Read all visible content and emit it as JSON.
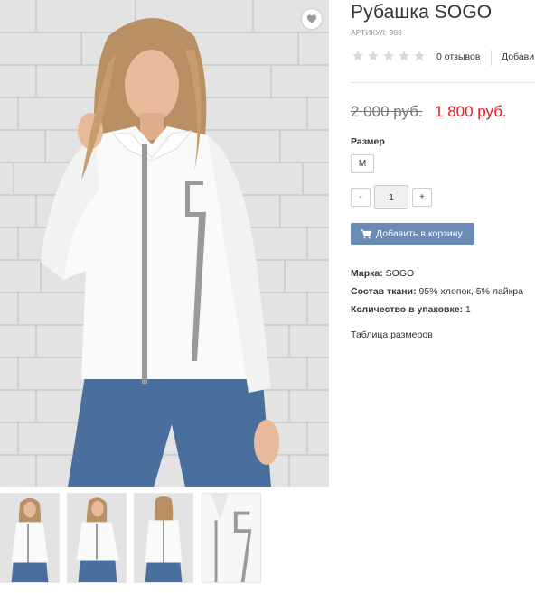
{
  "product": {
    "title": "Рубашка SOGO",
    "sku": "АРТИКУЛ: 988"
  },
  "rating": {
    "stars_filled": 0,
    "stars_total": 5,
    "reviews_text": "0 отзывов",
    "add_review_text": "Добави"
  },
  "price": {
    "old": "2 000 руб.",
    "current": "1 800 руб."
  },
  "size": {
    "label": "Размер",
    "options": [
      "M"
    ]
  },
  "quantity": {
    "minus": "-",
    "value": "1",
    "plus": "+"
  },
  "cart": {
    "label": "Добавить в корзину"
  },
  "attributes": [
    {
      "name": "Марка:",
      "value": " SOGO"
    },
    {
      "name": "Состав ткани:",
      "value": " 95% хлопок, 5% лайкра"
    },
    {
      "name": "Количество в упаковке:",
      "value": " 1"
    }
  ],
  "size_table_link": "Таблица размеров",
  "gallery": {
    "thumbnail_count": 4
  },
  "colors": {
    "price_new": "#e31e24",
    "cart_button": "#6a8bb6",
    "star_empty": "#d8d8d8"
  },
  "icons": {
    "wishlist": "heart-icon",
    "cart": "cart-icon",
    "star": "star-icon"
  }
}
